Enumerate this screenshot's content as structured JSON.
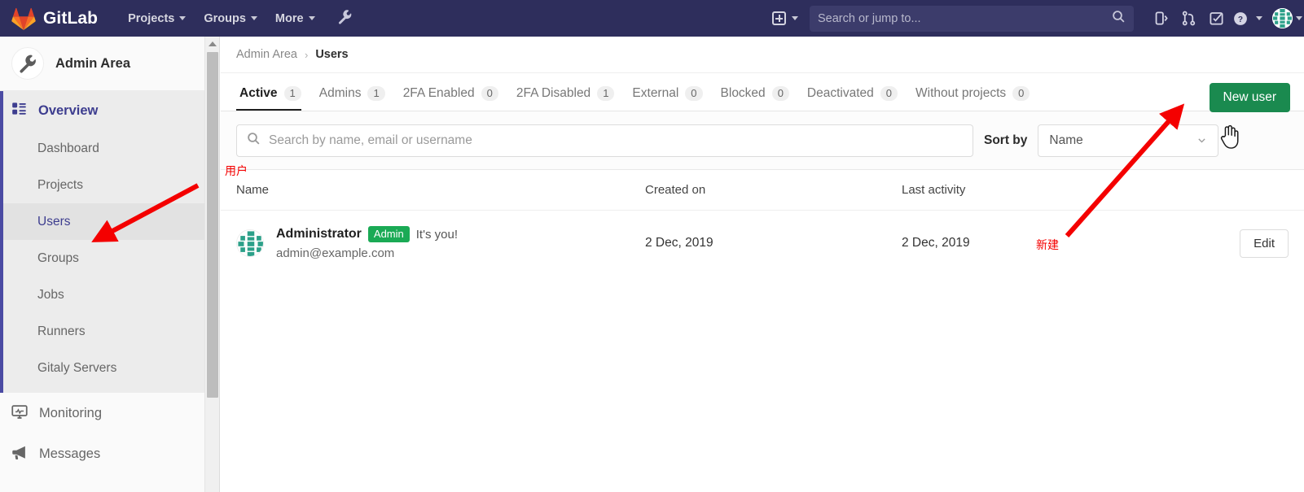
{
  "navbar": {
    "brand": "GitLab",
    "logo_icon": "gitlab-fox-logo",
    "links": [
      {
        "label": "Projects",
        "icon": "chevron-down-icon"
      },
      {
        "label": "Groups",
        "icon": "chevron-down-icon"
      },
      {
        "label": "More",
        "icon": "chevron-down-icon"
      }
    ],
    "admin_wrench_icon": "wrench-icon",
    "create_new_icon": "plus-square-icon",
    "search": {
      "placeholder": "Search or jump to...",
      "value": "",
      "icon": "search-icon"
    },
    "icons": [
      {
        "name": "issues-icon",
        "title": "Issues"
      },
      {
        "name": "merge-requests-icon",
        "title": "Merge requests"
      },
      {
        "name": "todos-icon",
        "title": "To-Do list"
      },
      {
        "name": "help-icon",
        "title": "Help"
      }
    ],
    "avatar_icon": "user-avatar-identicon"
  },
  "sidebar": {
    "title": "Admin Area",
    "title_icon": "wrench-icon",
    "overview": {
      "label": "Overview",
      "icon": "overview-grid-icon"
    },
    "items": [
      {
        "label": "Dashboard",
        "active": false
      },
      {
        "label": "Projects",
        "active": false
      },
      {
        "label": "Users",
        "active": true
      },
      {
        "label": "Groups",
        "active": false
      },
      {
        "label": "Jobs",
        "active": false
      },
      {
        "label": "Runners",
        "active": false
      },
      {
        "label": "Gitaly Servers",
        "active": false
      }
    ],
    "bottom_items": [
      {
        "label": "Monitoring",
        "icon": "monitor-icon"
      },
      {
        "label": "Messages",
        "icon": "megaphone-icon"
      }
    ]
  },
  "breadcrumb": {
    "parent": "Admin Area",
    "separator": "›",
    "current": "Users"
  },
  "tabs": [
    {
      "label": "Active",
      "count": "1",
      "active": true
    },
    {
      "label": "Admins",
      "count": "1",
      "active": false
    },
    {
      "label": "2FA Enabled",
      "count": "0",
      "active": false
    },
    {
      "label": "2FA Disabled",
      "count": "1",
      "active": false
    },
    {
      "label": "External",
      "count": "0",
      "active": false
    },
    {
      "label": "Blocked",
      "count": "0",
      "active": false
    },
    {
      "label": "Deactivated",
      "count": "0",
      "active": false
    },
    {
      "label": "Without projects",
      "count": "0",
      "active": false
    }
  ],
  "actions": {
    "new_user_label": "New user",
    "new_user_color": "#1a8a4f",
    "edit_label": "Edit"
  },
  "filters": {
    "search": {
      "placeholder": "Search by name, email or username",
      "value": "",
      "icon": "search-icon"
    },
    "sort_label": "Sort by",
    "sort_value": "Name",
    "sort_icon": "chevron-down-icon"
  },
  "table": {
    "columns": [
      "Name",
      "Created on",
      "Last activity"
    ],
    "rows": [
      {
        "avatar_icon": "user-avatar-identicon",
        "name": "Administrator",
        "badge": "Admin",
        "badge_color": "#1aaa55",
        "note": "It's you!",
        "email": "admin@example.com",
        "created_on": "2 Dec, 2019",
        "last_activity": "2 Dec, 2019",
        "action": "Edit"
      }
    ]
  },
  "annotations": {
    "color": "#f40000",
    "labels": [
      {
        "text": "用户",
        "target": "sidebar-item-users"
      },
      {
        "text": "新建",
        "target": "new-user-button"
      }
    ],
    "cursor": "pointing-hand-cursor"
  }
}
